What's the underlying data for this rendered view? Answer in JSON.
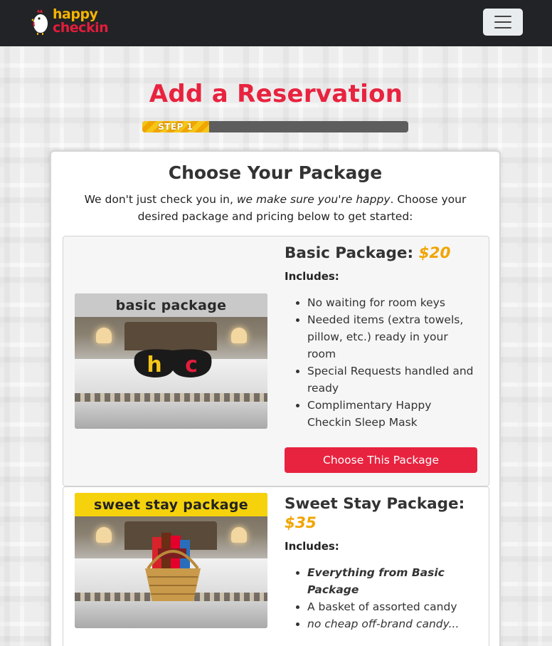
{
  "nav": {
    "logo_top": "happy",
    "logo_bottom": "checkin",
    "menu_icon": "hamburger-icon"
  },
  "page": {
    "title": "Add a Reservation",
    "progress": {
      "label": "STEP 1",
      "fraction": 0.25
    }
  },
  "card": {
    "title": "Choose Your Package",
    "intro_plain": "We don't just check you in, ",
    "intro_emph": "we make sure you're happy",
    "intro_tail": ". Choose your desired package and pricing below to get started:"
  },
  "packages": [
    {
      "name": "Basic Package: ",
      "price": "$20",
      "image_banner": "basic package",
      "mask_letters": [
        "h",
        "c"
      ],
      "includes_label": "Includes:",
      "items": [
        "No waiting for room keys",
        "Needed items (extra towels, pillow, etc.) ready in your room",
        "Special Requests handled and ready",
        "Complimentary Happy Checkin Sleep Mask"
      ],
      "button": "Choose This Package"
    },
    {
      "name": "Sweet Stay Package: ",
      "price": "$35",
      "image_banner": "sweet stay package",
      "includes_label": "Includes:",
      "items": [
        "Everything from Basic Package",
        "A basket of assorted candy",
        "no cheap off-brand candy..."
      ]
    }
  ],
  "colors": {
    "brand_red": "#e8233f",
    "price_gold": "#f0a500",
    "nav_bg": "#222326"
  }
}
